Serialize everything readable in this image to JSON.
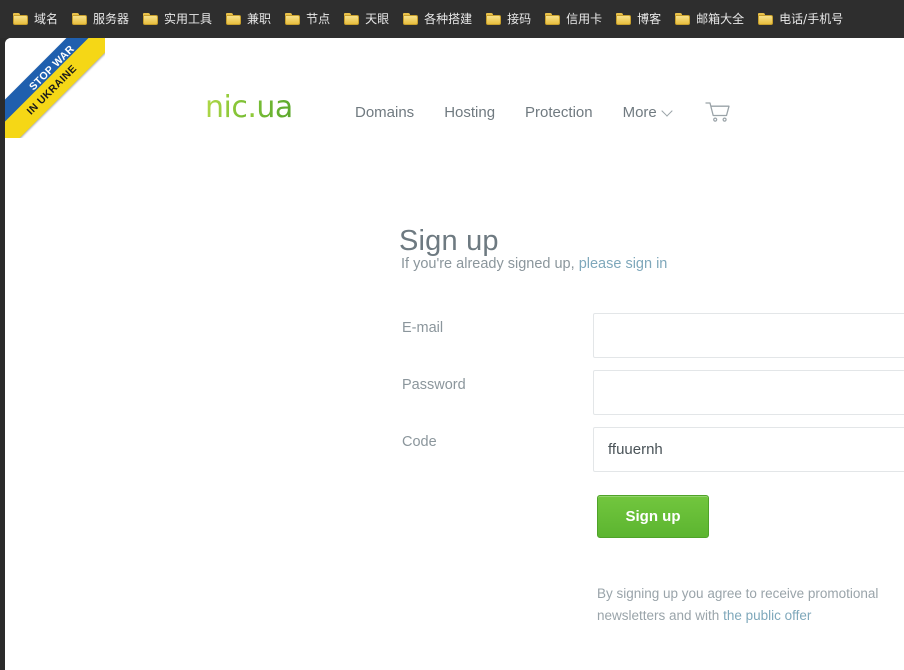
{
  "browser": {
    "bookmarks": [
      {
        "icon": "folder-icon",
        "label": "域名"
      },
      {
        "icon": "folder-icon",
        "label": "服务器"
      },
      {
        "icon": "folder-icon",
        "label": "实用工具"
      },
      {
        "icon": "folder-icon",
        "label": "兼职"
      },
      {
        "icon": "folder-icon",
        "label": "节点"
      },
      {
        "icon": "folder-icon",
        "label": "天眼"
      },
      {
        "icon": "folder-icon",
        "label": "各种搭建"
      },
      {
        "icon": "folder-icon",
        "label": "接码"
      },
      {
        "icon": "folder-icon",
        "label": "信用卡"
      },
      {
        "icon": "folder-icon",
        "label": "博客"
      },
      {
        "icon": "folder-icon",
        "label": "邮箱大全"
      },
      {
        "icon": "folder-icon",
        "label": "电话/手机号"
      }
    ]
  },
  "ribbon": {
    "line1": "STOP WAR",
    "line2": "IN UKRAINE",
    "color_top": "#1f5fae",
    "color_bottom": "#f5d716"
  },
  "header": {
    "logo": {
      "part1": "nic",
      "dot": ".",
      "part2": "ua",
      "color": "#8fc93a"
    },
    "nav": [
      {
        "label": "Domains",
        "has_chevron": false
      },
      {
        "label": "Hosting",
        "has_chevron": false
      },
      {
        "label": "Protection",
        "has_chevron": false
      },
      {
        "label": "More",
        "has_chevron": true
      }
    ],
    "cart": {
      "icon": "shopping-cart-icon"
    }
  },
  "signup": {
    "title": "Sign up",
    "signin_note_prefix": "If you're already signed up, ",
    "signin_link": "please sign in",
    "fields": [
      {
        "label": "E-mail",
        "value": "",
        "placeholder": "",
        "type": "text",
        "name": "email"
      },
      {
        "label": "Password",
        "value": "",
        "placeholder": "",
        "type": "password",
        "name": "password"
      },
      {
        "label": "Code",
        "value": "ffuuernh",
        "placeholder": "",
        "type": "text",
        "name": "code"
      }
    ],
    "submit_label": "Sign up",
    "submit_color": "#5cb530",
    "terms_prefix": "By signing up you agree to receive promotional newsletters and with ",
    "terms_link": "the public offer",
    "link_color": "#7fa8bb"
  }
}
